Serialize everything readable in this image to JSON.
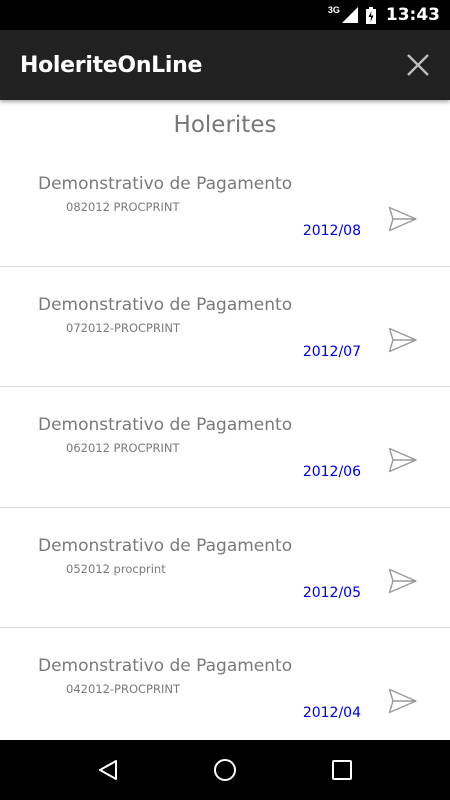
{
  "status_bar": {
    "network": "3G",
    "time": "13:43"
  },
  "app_bar": {
    "title": "HoleriteOnLine",
    "close_icon": "close-icon"
  },
  "section": {
    "title": "Holerites"
  },
  "items": [
    {
      "title": "Demonstrativo de Pagamento",
      "code": "082012 PROCPRINT",
      "date": "2012/08"
    },
    {
      "title": "Demonstrativo de Pagamento",
      "code": "072012-PROCPRINT",
      "date": "2012/07"
    },
    {
      "title": "Demonstrativo de Pagamento",
      "code": "062012 PROCPRINT",
      "date": "2012/06"
    },
    {
      "title": "Demonstrativo de Pagamento",
      "code": "052012 procprint",
      "date": "2012/05"
    },
    {
      "title": "Demonstrativo de Pagamento",
      "code": "042012-PROCPRINT",
      "date": "2012/04"
    }
  ],
  "colors": {
    "status_bar": "#000000",
    "app_bar": "#212121",
    "date_text": "#0000dd",
    "item_text": "#7a7a7a",
    "nav_bar": "#000000"
  }
}
